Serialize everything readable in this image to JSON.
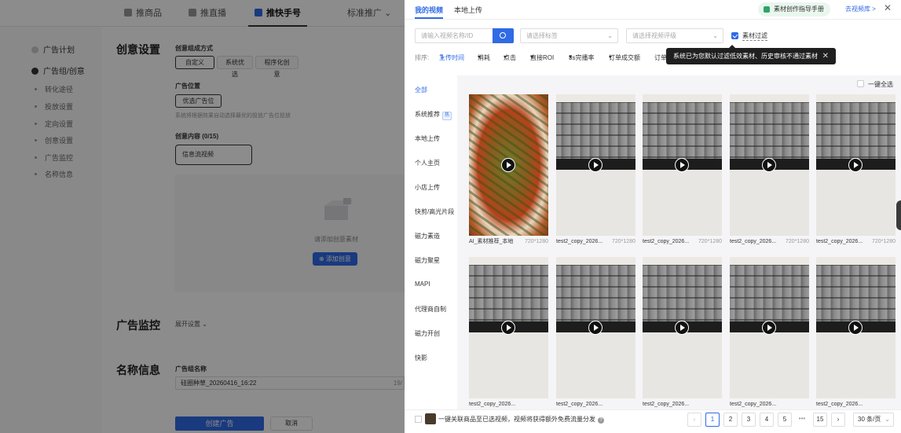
{
  "nav": {
    "tabs": [
      {
        "label": "推商品"
      },
      {
        "label": "推直播"
      },
      {
        "label": "推快手号"
      },
      {
        "label": "标准推广"
      }
    ],
    "active_index": 2,
    "dropdown_arrow": "chevron-down-icon"
  },
  "steps": [
    {
      "label": "广告计划",
      "kind": "main"
    },
    {
      "label": "广告组/创意",
      "kind": "main-current"
    },
    {
      "label": "转化途径",
      "kind": "sub"
    },
    {
      "label": "投放设置",
      "kind": "sub"
    },
    {
      "label": "定向设置",
      "kind": "sub"
    },
    {
      "label": "创意设置",
      "kind": "sub"
    },
    {
      "label": "广告监控",
      "kind": "sub"
    },
    {
      "label": "名称信息",
      "kind": "sub"
    }
  ],
  "form": {
    "section_creative": "创意设置",
    "compose_label": "创意组成方式",
    "compose_options": [
      "自定义",
      "系统优选",
      "程序化创意"
    ],
    "placement_label": "广告位置",
    "placement_button": "优选广告位",
    "placement_hint": "系统将根据效果自动选择最优的投放广告位投放",
    "content_label": "创意内容 (0/15)",
    "content_type": "信息流视频",
    "dropzone_hint": "请添加创意素材",
    "add_button": "添加创意",
    "section_monitor": "广告监控",
    "monitor_expand": "展开设置",
    "section_name": "名称信息",
    "group_name_label": "广告组名称",
    "group_name_value": "硅圈种草_20260416_16:22",
    "group_name_count": "19/",
    "create_button": "创建广告",
    "cancel_button": "取消"
  },
  "drawer": {
    "tabs": [
      "我的视频",
      "本地上传"
    ],
    "guide_button": "素材创作指导手册",
    "library_link": "去视频库 >",
    "search_placeholder": "请输入视频名称/ID",
    "tag_placeholder": "请选择标签",
    "rating_placeholder": "请选择视频评级",
    "filter_label": "素材过滤",
    "filter_checked": true,
    "sort_label": "排序:",
    "sort_items": [
      "上传时间",
      "消耗",
      "点击",
      "直接ROI",
      "3s完播率",
      "订单成交额",
      "订单"
    ],
    "sort_active_index": 0,
    "tooltip": "系统已为您默认过滤低效素材、历史审核不通过素材",
    "select_all": "一键全选",
    "categories": [
      "全部",
      "系统推荐",
      "本地上传",
      "个人主页",
      "小店上传",
      "快剪/高光片段",
      "磁力素造",
      "磁力聚星",
      "MAPI",
      "代理商自制",
      "磁力开创",
      "快影"
    ],
    "category_badge": "热",
    "category_active_index": 0,
    "videos": [
      {
        "name": "AI_素材推荐_本地",
        "res": "720*1280",
        "kind": "food"
      },
      {
        "name": "test2_copy_2026...",
        "res": "720*1280",
        "kind": "keyboard"
      },
      {
        "name": "test2_copy_2026...",
        "res": "720*1280",
        "kind": "keyboard"
      },
      {
        "name": "test2_copy_2026...",
        "res": "720*1280",
        "kind": "keyboard"
      },
      {
        "name": "test2_copy_2026...",
        "res": "720*1280",
        "kind": "keyboard"
      },
      {
        "name": "test2_copy_2026...",
        "res": "",
        "kind": "keyboard"
      },
      {
        "name": "test2_copy_2026...",
        "res": "",
        "kind": "keyboard"
      },
      {
        "name": "test2_copy_2026...",
        "res": "",
        "kind": "keyboard"
      },
      {
        "name": "test2_copy_2026...",
        "res": "",
        "kind": "keyboard"
      },
      {
        "name": "test2_copy_2026...",
        "res": "",
        "kind": "keyboard"
      }
    ],
    "footer_text": "一键关联商品至已选视频，视频将获得额外免费流量分发",
    "pages": [
      "1",
      "2",
      "3",
      "4",
      "5",
      "•••",
      "15"
    ],
    "active_page": "1",
    "page_size": "30 条/页"
  },
  "colors": {
    "accent": "#2f6be5",
    "tooltip_bg": "#1f1f1f",
    "guide_bg": "#e9f7ee"
  }
}
